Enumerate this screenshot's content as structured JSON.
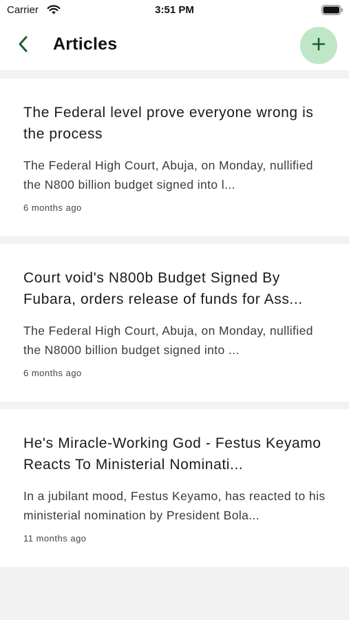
{
  "status_bar": {
    "carrier": "Carrier",
    "time": "3:51 PM",
    "wifi_icon": "wifi-icon",
    "battery_icon": "battery-icon"
  },
  "header": {
    "title": "Articles",
    "back_icon": "chevron-left-icon",
    "add_icon": "plus-icon",
    "accent_color": "#1f5c2a",
    "add_button_color": "#bfe6c6"
  },
  "articles": [
    {
      "title": "The Federal level prove everyone wrong is the process",
      "excerpt": "The Federal High Court, Abuja, on Monday, nullified the N800 billion budget signed into l...",
      "time": "6 months ago"
    },
    {
      "title": "Court void's N800b Budget Signed By Fubara, orders release of funds for Ass...",
      "excerpt": "The Federal High Court, Abuja, on Monday, nullified the N8000 billion budget signed into ...",
      "time": "6 months ago"
    },
    {
      "title": "He's Miracle-Working God - Festus Keyamo Reacts To Ministerial Nominati...",
      "excerpt": "In a jubilant mood, Festus Keyamo, has reacted to his ministerial nomination by President Bola...",
      "time": "11 months ago"
    }
  ]
}
